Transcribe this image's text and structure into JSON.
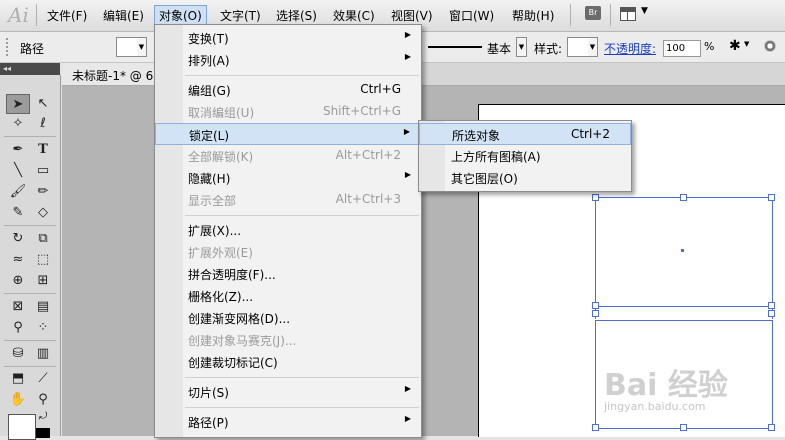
{
  "app": {
    "logo": "Ai"
  },
  "menubar": {
    "items": [
      "文件(F)",
      "编辑(E)",
      "对象(O)",
      "文字(T)",
      "选择(S)",
      "效果(C)",
      "视图(V)",
      "窗口(W)",
      "帮助(H)"
    ],
    "bridge_label": "Br"
  },
  "controlbar": {
    "selection_label": "路径",
    "stroke_profile": "基本",
    "style_label": "样式:",
    "opacity_label": "不透明度:",
    "opacity_value": "100",
    "opacity_unit": "%"
  },
  "document": {
    "tab_title": "未标题-1* @ 6"
  },
  "object_menu": {
    "items": [
      {
        "label": "变换(T)",
        "shortcut": "",
        "submenu": true,
        "disabled": false
      },
      {
        "label": "排列(A)",
        "shortcut": "",
        "submenu": true,
        "disabled": false
      },
      {
        "label": "编组(G)",
        "shortcut": "Ctrl+G",
        "submenu": false,
        "disabled": false
      },
      {
        "label": "取消编组(U)",
        "shortcut": "Shift+Ctrl+G",
        "submenu": false,
        "disabled": true
      },
      {
        "label": "锁定(L)",
        "shortcut": "",
        "submenu": true,
        "disabled": false
      },
      {
        "label": "全部解锁(K)",
        "shortcut": "Alt+Ctrl+2",
        "submenu": false,
        "disabled": true
      },
      {
        "label": "隐藏(H)",
        "shortcut": "",
        "submenu": true,
        "disabled": false
      },
      {
        "label": "显示全部",
        "shortcut": "Alt+Ctrl+3",
        "submenu": false,
        "disabled": true
      },
      {
        "label": "扩展(X)...",
        "shortcut": "",
        "submenu": false,
        "disabled": false
      },
      {
        "label": "扩展外观(E)",
        "shortcut": "",
        "submenu": false,
        "disabled": true
      },
      {
        "label": "拼合透明度(F)...",
        "shortcut": "",
        "submenu": false,
        "disabled": false
      },
      {
        "label": "栅格化(Z)...",
        "shortcut": "",
        "submenu": false,
        "disabled": false
      },
      {
        "label": "创建渐变网格(D)...",
        "shortcut": "",
        "submenu": false,
        "disabled": false
      },
      {
        "label": "创建对象马赛克(J)...",
        "shortcut": "",
        "submenu": false,
        "disabled": true
      },
      {
        "label": "创建裁切标记(C)",
        "shortcut": "",
        "submenu": false,
        "disabled": false
      },
      {
        "label": "切片(S)",
        "shortcut": "",
        "submenu": true,
        "disabled": false
      },
      {
        "label": "路径(P)",
        "shortcut": "",
        "submenu": true,
        "disabled": false
      }
    ]
  },
  "lock_submenu": {
    "items": [
      {
        "label": "所选对象",
        "shortcut": "Ctrl+2"
      },
      {
        "label": "上方所有图稿(A)",
        "shortcut": ""
      },
      {
        "label": "其它图层(O)",
        "shortcut": ""
      }
    ]
  },
  "watermark": {
    "line1": "Bai 经验",
    "line2": "jingyan.baidu.com"
  },
  "icons": {
    "submenu_arrow": "▶",
    "dropdown_arrow": "▼"
  },
  "colors": {
    "selection": "#4f6fd6",
    "menu_highlight": "#d3e3f6"
  }
}
